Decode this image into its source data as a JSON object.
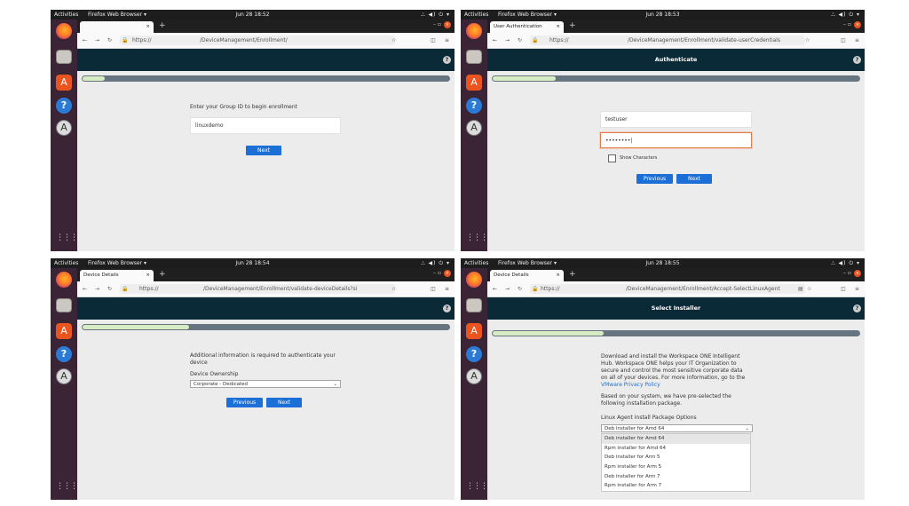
{
  "system": {
    "activities": "Activities",
    "app_menu": "Firefox Web Browser ▾",
    "tray": "⛬ ◀) ⏻ ▾",
    "new_tab": "+",
    "window_controls": "–  ▫",
    "close_glyph": "×",
    "grid_glyph": "⋮⋮⋮"
  },
  "panels": [
    {
      "clock": "Jun 28  18:52",
      "tab_title": "",
      "url_prefix": "https://",
      "url_path": "/DeviceManagement/Enrollment/",
      "header_title": "",
      "progress": 0.06,
      "label": "Enter your Group ID to begin enrollment",
      "group_id_value": "linuxdemo",
      "next_label": "Next"
    },
    {
      "clock": "Jun 28  18:53",
      "tab_title": "User Authentication",
      "url_prefix": "https://",
      "url_path": "/DeviceManagement/Enrollment/validate-userCredentials",
      "header_title": "Authenticate",
      "progress": 0.17,
      "username_value": "testuser",
      "password_value": "••••••••|",
      "show_characters": "Show Characters",
      "previous_label": "Previous",
      "next_label": "Next"
    },
    {
      "clock": "Jun 28  18:54",
      "tab_title": "Device Details",
      "url_prefix": "https://",
      "url_path": "/DeviceManagement/Enrollment/validate-deviceDetails?si",
      "header_title": "",
      "progress": 0.29,
      "info_text": "Additional information is required to authenticate your device",
      "ownership_label": "Device Ownership",
      "ownership_value": "Corporate - Dedicated",
      "previous_label": "Previous",
      "next_label": "Next"
    },
    {
      "clock": "Jun 28  18:55",
      "tab_title": "Device Details",
      "url_prefix": "https://",
      "url_path": "/DeviceManagement/Enrollment/Accept-SelectLinuxAgent",
      "header_title": "Select Installer",
      "progress": 0.3,
      "intro_text": "Download and install the Workspace ONE Intelligent Hub. Workspace ONE helps your IT Organization to secure and control the most sensitive corporate data on all of your devices. For more information, go to the",
      "privacy_link": "VMware Privacy Policy",
      "preselect_text": "Based on your system, we have pre-selected the following installation package.",
      "options_label": "Linux Agent Install Package Options",
      "selected_value": "Deb installer for Amd 64",
      "options": [
        "Deb installer for Amd 64",
        "Rpm installer for Amd 64",
        "Deb installer for Arm 5",
        "Rpm installer for Arm 5",
        "Deb installer for Arm 7",
        "Rpm installer for Arm 7"
      ]
    }
  ]
}
